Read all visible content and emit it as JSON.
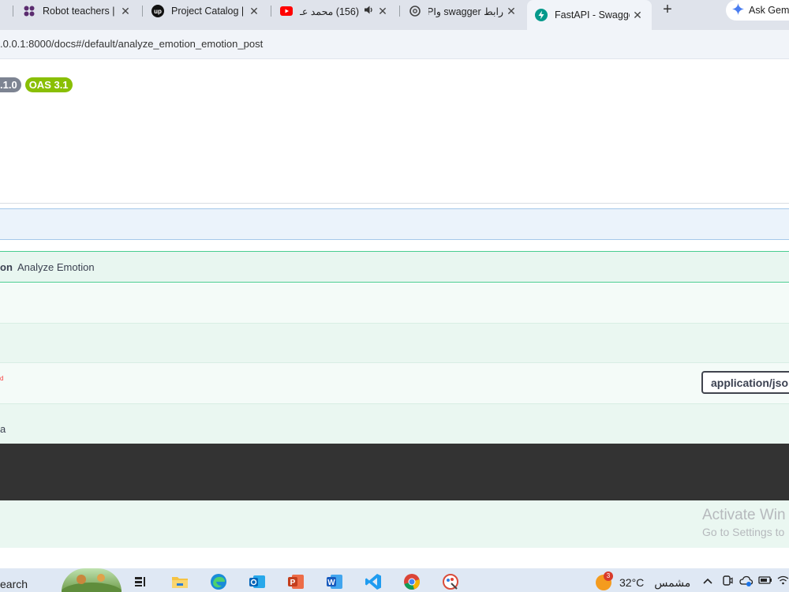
{
  "browser": {
    "tabs": [
      {
        "label": "Robot teachers | ",
        "icon": "slack-icon"
      },
      {
        "label": "Project Catalog | ",
        "icon": "upwork-icon"
      },
      {
        "label": "(156) محمد عـ",
        "icon": "youtube-icon"
      },
      {
        "label": "رابط swagger وAPI",
        "icon": "chatgpt-icon"
      },
      {
        "label": "FastAPI - Swagge",
        "icon": "fastapi-icon",
        "active": true
      }
    ],
    "ask_gemini": "Ask Gem",
    "url": ".0.0.1:8000/docs#/default/analyze_emotion_emotion_post"
  },
  "swagger": {
    "version_badge": ".1.0",
    "oas_badge": "OAS 3.1",
    "operation": {
      "path_tail": "on",
      "summary": "Analyze Emotion"
    },
    "request_body": {
      "required_tail": "d",
      "content_type": "application/jso"
    },
    "schema_tail": "a"
  },
  "os": {
    "watermark_line1": "Activate Win",
    "watermark_line2": "Go to Settings to",
    "taskbar": {
      "search_tail": "earch",
      "weather_badge": "3",
      "temperature": "32°C",
      "weather_text": "مشمس"
    }
  },
  "colors": {
    "post_green": "#49cc90",
    "oas_green": "#89bf04",
    "version_gray": "#7d8492"
  }
}
